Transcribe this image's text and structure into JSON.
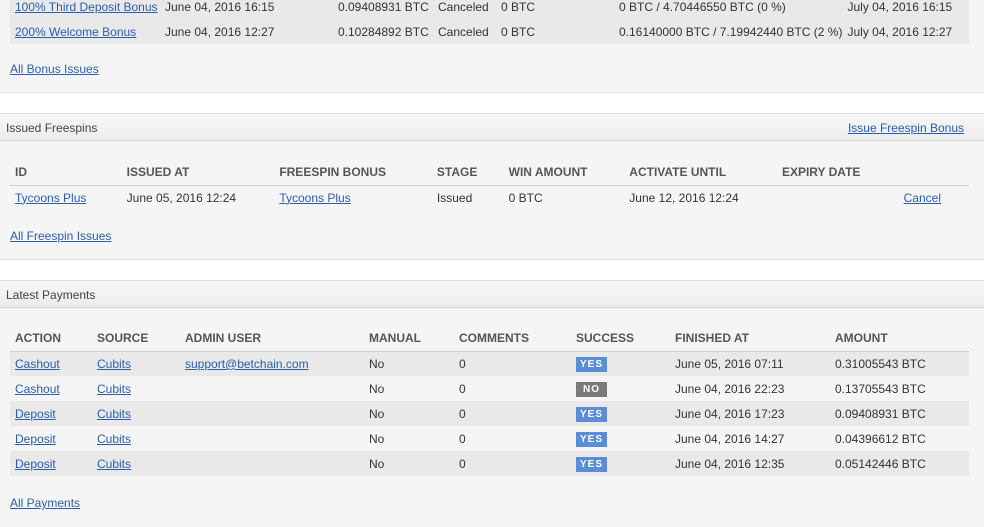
{
  "bonus_issues": {
    "rows": [
      {
        "name": "100% Third Deposit Bonus",
        "date": "June 04, 2016 16:15",
        "amount": "0.09408931 BTC",
        "status": "Canceled",
        "win": "0 BTC",
        "wagered": "0 BTC / 4.70446550 BTC (0 %)",
        "expires": "July 04, 2016 16:15"
      },
      {
        "name": "200% Welcome Bonus",
        "date": "June 04, 2016 12:27",
        "amount": "0.10284892 BTC",
        "status": "Canceled",
        "win": "0 BTC",
        "wagered": "0.16140000 BTC / 7.19942440 BTC (2 %)",
        "expires": "July 04, 2016 12:27"
      }
    ],
    "all_link": "All Bonus Issues"
  },
  "freespins": {
    "title": "Issued Freespins",
    "issue_link": "Issue Freespin Bonus",
    "columns": [
      "ID",
      "ISSUED AT",
      "FREESPIN BONUS",
      "STAGE",
      "WIN AMOUNT",
      "ACTIVATE UNTIL",
      "EXPIRY DATE"
    ],
    "rows": [
      {
        "id": "Tycoons Plus",
        "issued_at": "June 05, 2016 12:24",
        "bonus": "Tycoons Plus",
        "stage": "Issued",
        "win": "0 BTC",
        "activate_until": "June 12, 2016 12:24",
        "expiry": "",
        "action": "Cancel"
      }
    ],
    "all_link": "All Freespin Issues"
  },
  "payments": {
    "title": "Latest Payments",
    "columns": [
      "ACTION",
      "SOURCE",
      "ADMIN USER",
      "MANUAL",
      "COMMENTS",
      "SUCCESS",
      "FINISHED AT",
      "AMOUNT"
    ],
    "rows": [
      {
        "action": "Cashout",
        "source": "Cubits",
        "admin": "support@betchain.com",
        "manual": "No",
        "comments": "0",
        "success": "YES",
        "finished": "June 05, 2016 07:11",
        "amount": "0.31005543 BTC"
      },
      {
        "action": "Cashout",
        "source": "Cubits",
        "admin": "",
        "manual": "No",
        "comments": "0",
        "success": "NO",
        "finished": "June 04, 2016 22:23",
        "amount": "0.13705543 BTC"
      },
      {
        "action": "Deposit",
        "source": "Cubits",
        "admin": "",
        "manual": "No",
        "comments": "0",
        "success": "YES",
        "finished": "June 04, 2016 17:23",
        "amount": "0.09408931 BTC"
      },
      {
        "action": "Deposit",
        "source": "Cubits",
        "admin": "",
        "manual": "No",
        "comments": "0",
        "success": "YES",
        "finished": "June 04, 2016 14:27",
        "amount": "0.04396612 BTC"
      },
      {
        "action": "Deposit",
        "source": "Cubits",
        "admin": "",
        "manual": "No",
        "comments": "0",
        "success": "YES",
        "finished": "June 04, 2016 12:35",
        "amount": "0.05142446 BTC"
      }
    ],
    "all_link": "All Payments"
  },
  "colors": {
    "link": "#2a5db0",
    "badge_yes": "#5b8dd6",
    "badge_no": "#7a7a7a"
  }
}
